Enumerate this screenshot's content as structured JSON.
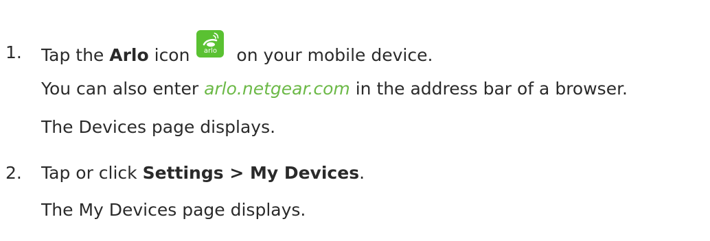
{
  "steps": [
    {
      "number": "1.",
      "before": "Tap the ",
      "bold": "Arlo",
      "middle": " icon",
      "after": " on your mobile device.",
      "note1_before": "You can also enter ",
      "note1_link": "arlo.netgear.com",
      "note1_after": " in the address bar of a browser.",
      "note2": "The Devices  page displays."
    },
    {
      "number": "2.",
      "before": "Tap or click ",
      "bold": "Settings > My Devices",
      "after": ".",
      "note1": "The My Devices page displays."
    }
  ],
  "icon": {
    "name": "arlo-app-icon",
    "logo_text": "arlo",
    "color": "#5ac132"
  },
  "colors": {
    "text": "#2a2a2a",
    "link": "#6cb947"
  }
}
